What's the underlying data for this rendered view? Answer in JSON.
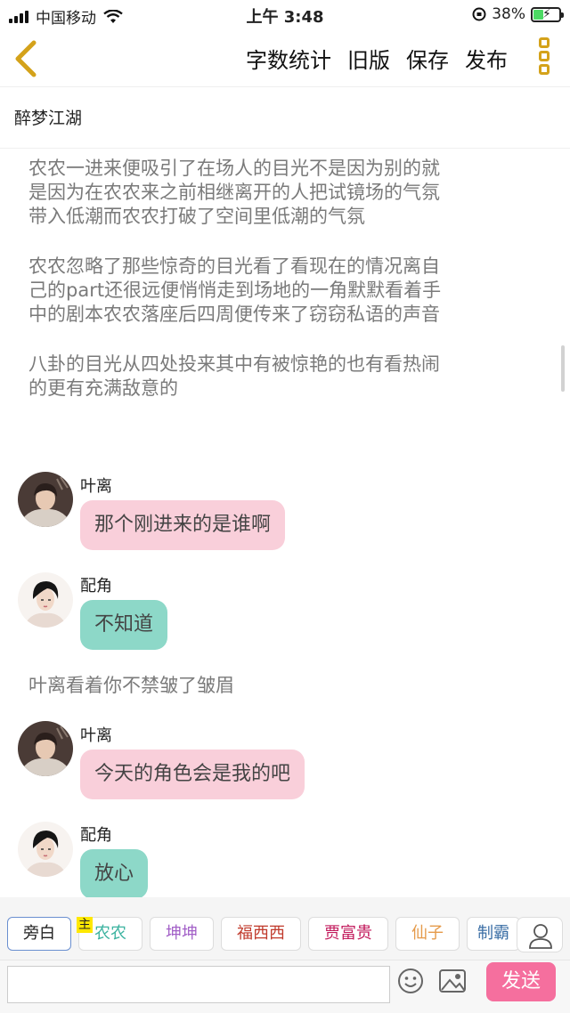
{
  "status_bar": {
    "carrier": "中国移动",
    "time": "上午 3:48",
    "battery": "38%",
    "battery_level": 0.38
  },
  "navbar": {
    "actions": [
      "字数统计",
      "旧版",
      "保存",
      "发布"
    ],
    "back_icon": "chevron-left-icon",
    "more_icon": "vertical-dots-icon",
    "accent": "#d4a21a"
  },
  "document": {
    "title": "醉梦江湖",
    "paragraphs": [
      [
        "农农一进来便吸引了在场人的目光不是因为别的就",
        "是因为在农农来之前相继离开的人把试镜场的气氛",
        "带入低潮而农农打破了空间里低潮的气氛"
      ],
      [
        "农农忽略了那些惊奇的目光看了看现在的情况离自",
        "己的part还很远便悄悄走到场地的一角默默看着手",
        "中的剧本农农落座后四周便传来了窃窃私语的声音"
      ],
      [
        "八卦的目光从四处投来其中有被惊艳的也有看热闹",
        "的更有充满敌意的"
      ]
    ]
  },
  "chat": {
    "messages": [
      {
        "speaker": "叶离",
        "text": "那个刚进来的是谁啊"
      },
      {
        "speaker": "配角",
        "text": "不知道"
      },
      {
        "speaker": "叶离",
        "text": "今天的角色会是我的吧"
      },
      {
        "speaker": "配角",
        "text": "放心"
      }
    ],
    "aside": "叶离看着你不禁皱了皱眉",
    "colors": {
      "pink_bubble": "#f9cfda",
      "teal_bubble": "#8dd8c8"
    }
  },
  "roles": {
    "items": [
      {
        "label": "旁白",
        "color": "#222222"
      },
      {
        "label": "农农",
        "color": "#3cb3a0"
      },
      {
        "label": "坤坤",
        "color": "#a25fc7"
      },
      {
        "label": "福西西",
        "color": "#c0392b"
      },
      {
        "label": "贾富贵",
        "color": "#c2185b"
      },
      {
        "label": "仙子",
        "color": "#e59a4a"
      },
      {
        "label": "制霸",
        "color": "#3a6ea5"
      }
    ],
    "main_tag": "主",
    "person_icon": "person-icon"
  },
  "composer": {
    "placeholder": "",
    "send_label": "发送",
    "emoji_icon": "emoji-icon",
    "image_icon": "image-icon"
  }
}
